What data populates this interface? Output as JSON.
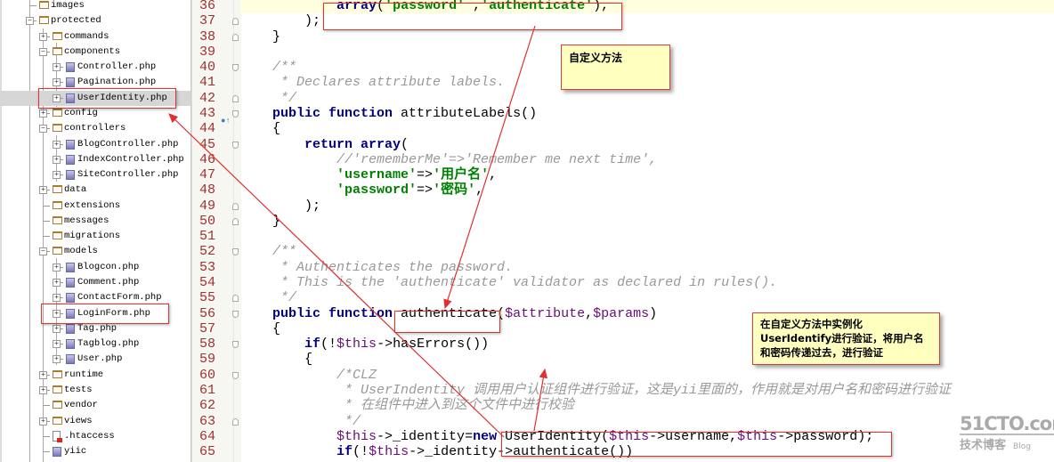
{
  "sidebar": {
    "items": [
      {
        "label": "images",
        "level": 0,
        "type": "folder",
        "exp": ""
      },
      {
        "label": "protected",
        "level": 0,
        "type": "folder",
        "exp": "-"
      },
      {
        "label": "commands",
        "level": 1,
        "type": "folder",
        "exp": "+"
      },
      {
        "label": "components",
        "level": 1,
        "type": "folder",
        "exp": "-"
      },
      {
        "label": "Controller.php",
        "level": 2,
        "type": "file",
        "exp": "+"
      },
      {
        "label": "Pagination.php",
        "level": 2,
        "type": "file",
        "exp": "+"
      },
      {
        "label": "UserIdentity.php",
        "level": 2,
        "type": "file",
        "exp": "+",
        "selected": true
      },
      {
        "label": "config",
        "level": 1,
        "type": "folder",
        "exp": "+"
      },
      {
        "label": "controllers",
        "level": 1,
        "type": "folder",
        "exp": "-"
      },
      {
        "label": "BlogController.php",
        "level": 2,
        "type": "file",
        "exp": "+"
      },
      {
        "label": "IndexController.php",
        "level": 2,
        "type": "file",
        "exp": "+"
      },
      {
        "label": "SiteController.php",
        "level": 2,
        "type": "file",
        "exp": "+"
      },
      {
        "label": "data",
        "level": 1,
        "type": "folder",
        "exp": "+"
      },
      {
        "label": "extensions",
        "level": 1,
        "type": "folder",
        "exp": ""
      },
      {
        "label": "messages",
        "level": 1,
        "type": "folder",
        "exp": ""
      },
      {
        "label": "migrations",
        "level": 1,
        "type": "folder",
        "exp": ""
      },
      {
        "label": "models",
        "level": 1,
        "type": "folder",
        "exp": "-"
      },
      {
        "label": "Blogcon.php",
        "level": 2,
        "type": "file",
        "exp": "+"
      },
      {
        "label": "Comment.php",
        "level": 2,
        "type": "file",
        "exp": "+"
      },
      {
        "label": "ContactForm.php",
        "level": 2,
        "type": "file",
        "exp": "+"
      },
      {
        "label": "LoginForm.php",
        "level": 2,
        "type": "file",
        "exp": "+"
      },
      {
        "label": "Tag.php",
        "level": 2,
        "type": "file",
        "exp": "+"
      },
      {
        "label": "Tagblog.php",
        "level": 2,
        "type": "file",
        "exp": "+"
      },
      {
        "label": "User.php",
        "level": 2,
        "type": "file",
        "exp": "+"
      },
      {
        "label": "runtime",
        "level": 1,
        "type": "folder",
        "exp": "+"
      },
      {
        "label": "tests",
        "level": 1,
        "type": "folder",
        "exp": "+"
      },
      {
        "label": "vendor",
        "level": 1,
        "type": "folder",
        "exp": ""
      },
      {
        "label": "views",
        "level": 1,
        "type": "folder",
        "exp": "+"
      },
      {
        "label": ".htaccess",
        "level": 1,
        "type": "htaccess",
        "exp": ""
      },
      {
        "label": "yiic",
        "level": 1,
        "type": "file",
        "exp": ""
      }
    ]
  },
  "editor": {
    "current_line": 36,
    "lines": [
      {
        "n": "36",
        "fold": "",
        "t": [
          [
            "",
            "            "
          ],
          [
            "kw",
            "array"
          ],
          [
            "",
            "("
          ],
          [
            "str",
            "'password'"
          ],
          [
            "",
            " ,"
          ],
          [
            "str",
            "'authenticate'"
          ],
          [
            "",
            "),"
          ]
        ]
      },
      {
        "n": "37",
        "fold": "up",
        "t": [
          [
            "",
            "        );"
          ]
        ]
      },
      {
        "n": "38",
        "fold": "up",
        "t": [
          [
            "",
            "    }"
          ]
        ]
      },
      {
        "n": "39",
        "fold": "",
        "t": []
      },
      {
        "n": "40",
        "fold": "down",
        "t": [
          [
            "cmt",
            "    /**"
          ]
        ]
      },
      {
        "n": "41",
        "fold": "",
        "t": [
          [
            "cmt",
            "     * Declares attribute labels."
          ]
        ]
      },
      {
        "n": "42",
        "fold": "up",
        "t": [
          [
            "cmt",
            "     */"
          ]
        ]
      },
      {
        "n": "43",
        "fold": "down",
        "t": [
          [
            "",
            "    "
          ],
          [
            "kw",
            "public function"
          ],
          [
            "",
            " attributeLabels()"
          ]
        ]
      },
      {
        "n": "44",
        "fold": "",
        "t": [
          [
            "",
            "    {"
          ]
        ]
      },
      {
        "n": "45",
        "fold": "down",
        "t": [
          [
            "",
            "        "
          ],
          [
            "kw",
            "return array"
          ],
          [
            "",
            "("
          ]
        ]
      },
      {
        "n": "46",
        "fold": "",
        "t": [
          [
            "cmt",
            "            //'rememberMe'=>'Remember me next time',"
          ]
        ]
      },
      {
        "n": "47",
        "fold": "",
        "t": [
          [
            "",
            "            "
          ],
          [
            "str",
            "'username'"
          ],
          [
            "",
            "=>"
          ],
          [
            "str",
            "'用户名'"
          ],
          [
            "",
            ","
          ]
        ]
      },
      {
        "n": "48",
        "fold": "",
        "t": [
          [
            "",
            "            "
          ],
          [
            "str",
            "'password'"
          ],
          [
            "",
            "=>"
          ],
          [
            "str",
            "'密码'"
          ],
          [
            "",
            ","
          ]
        ]
      },
      {
        "n": "49",
        "fold": "up",
        "t": [
          [
            "",
            "        );"
          ]
        ]
      },
      {
        "n": "50",
        "fold": "up",
        "t": [
          [
            "",
            "    }"
          ]
        ]
      },
      {
        "n": "51",
        "fold": "",
        "t": []
      },
      {
        "n": "52",
        "fold": "down",
        "t": [
          [
            "cmt",
            "    /**"
          ]
        ]
      },
      {
        "n": "53",
        "fold": "",
        "t": [
          [
            "cmt",
            "     * Authenticates the password."
          ]
        ]
      },
      {
        "n": "54",
        "fold": "",
        "t": [
          [
            "cmt",
            "     * This is the 'authenticate' validator as declared in rules()."
          ]
        ]
      },
      {
        "n": "55",
        "fold": "up",
        "t": [
          [
            "cmt",
            "     */"
          ]
        ]
      },
      {
        "n": "56",
        "fold": "down",
        "t": [
          [
            "",
            "    "
          ],
          [
            "kw",
            "public function"
          ],
          [
            "",
            " authenticate("
          ],
          [
            "var",
            "$attribute"
          ],
          [
            "",
            ","
          ],
          [
            "var",
            "$params"
          ],
          [
            "",
            ")"
          ]
        ]
      },
      {
        "n": "57",
        "fold": "",
        "t": [
          [
            "",
            "    {"
          ]
        ]
      },
      {
        "n": "58",
        "fold": "down",
        "t": [
          [
            "",
            "        "
          ],
          [
            "kw",
            "if"
          ],
          [
            "",
            "(!"
          ],
          [
            "var",
            "$this"
          ],
          [
            "",
            "->hasErrors())"
          ]
        ]
      },
      {
        "n": "59",
        "fold": "",
        "t": [
          [
            "",
            "        {"
          ]
        ]
      },
      {
        "n": "60",
        "fold": "down",
        "t": [
          [
            "cmt",
            "            /*CLZ"
          ]
        ]
      },
      {
        "n": "61",
        "fold": "",
        "t": [
          [
            "cmt",
            "             * UserIndentity 调用用户认证组件进行验证，这是yii里面的，作用就是对用户名和密码进行验证"
          ]
        ]
      },
      {
        "n": "62",
        "fold": "",
        "t": [
          [
            "cmt",
            "             * 在组件中进入到这个文件中进行校验"
          ]
        ]
      },
      {
        "n": "63",
        "fold": "up",
        "t": [
          [
            "cmt",
            "             */"
          ]
        ]
      },
      {
        "n": "64",
        "fold": "",
        "t": [
          [
            "",
            "            "
          ],
          [
            "var",
            "$this"
          ],
          [
            "",
            "->_identity="
          ],
          [
            "kw",
            "new"
          ],
          [
            "",
            " UserIdentity("
          ],
          [
            "var",
            "$this"
          ],
          [
            "",
            "->username,"
          ],
          [
            "var",
            "$this"
          ],
          [
            "",
            "->password);"
          ]
        ]
      },
      {
        "n": "65",
        "fold": "",
        "t": [
          [
            "",
            "            "
          ],
          [
            "kw",
            "if"
          ],
          [
            "",
            "(!"
          ],
          [
            "var",
            "$this"
          ],
          [
            "",
            "->_identity->authenticate())"
          ]
        ]
      }
    ]
  },
  "annotations": {
    "note1": "自定义方法",
    "note2": "在自定义方法中实例化UserIdentify进行验证，将用户名和密码传递过去，进行验证"
  },
  "watermark": {
    "site": "51CTO.com",
    "sub": "技术博客",
    "blog": "Blog"
  },
  "colors": {
    "annotation_red": "#e03030",
    "note_bg": "#ffffc0",
    "line_number": "#a03030",
    "keyword": "#000080",
    "string": "#008000",
    "comment": "#999999"
  }
}
